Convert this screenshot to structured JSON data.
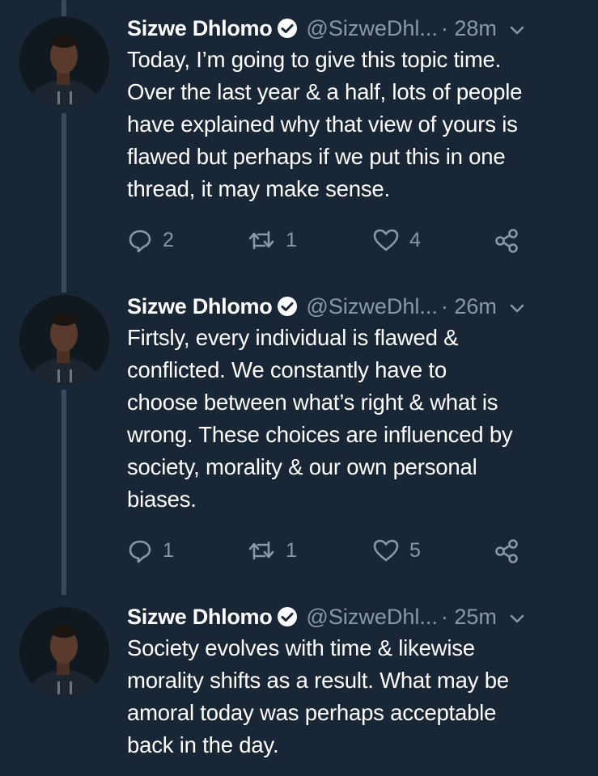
{
  "tweets": [
    {
      "author_name": "Sizwe Dhlomo",
      "handle": "@SizweDhl...",
      "time": "· 28m",
      "text_lines": [
        "Today, I’m going to give this topic time.",
        "Over the last year & a half, lots of people",
        "have explained why that view of yours is",
        "flawed but perhaps if we put this in one",
        "thread, it may make sense."
      ],
      "replies": "2",
      "retweets": "1",
      "likes": "4"
    },
    {
      "author_name": "Sizwe Dhlomo",
      "handle": "@SizweDhl...",
      "time": "· 26m",
      "text_lines": [
        "Firtsly, every individual is flawed &",
        "conflicted. We constantly have to",
        "choose between what’s right & what is",
        "wrong. These choices are influenced by",
        "society, morality & our own personal",
        "biases."
      ],
      "replies": "1",
      "retweets": "1",
      "likes": "5"
    },
    {
      "author_name": "Sizwe Dhlomo",
      "handle": "@SizweDhl...",
      "time": "· 25m",
      "text_lines": [
        "Society evolves with time & likewise",
        "morality shifts as a result. What may be",
        "amoral today was perhaps acceptable",
        "back in the day."
      ]
    }
  ],
  "colors": {
    "background": "#192636",
    "text": "#ffffff",
    "muted": "#8899a6",
    "thread_line": "#3a4a5c"
  },
  "icons": [
    "verified-badge-icon",
    "chevron-down-icon",
    "reply-icon",
    "retweet-icon",
    "like-icon",
    "share-icon"
  ]
}
